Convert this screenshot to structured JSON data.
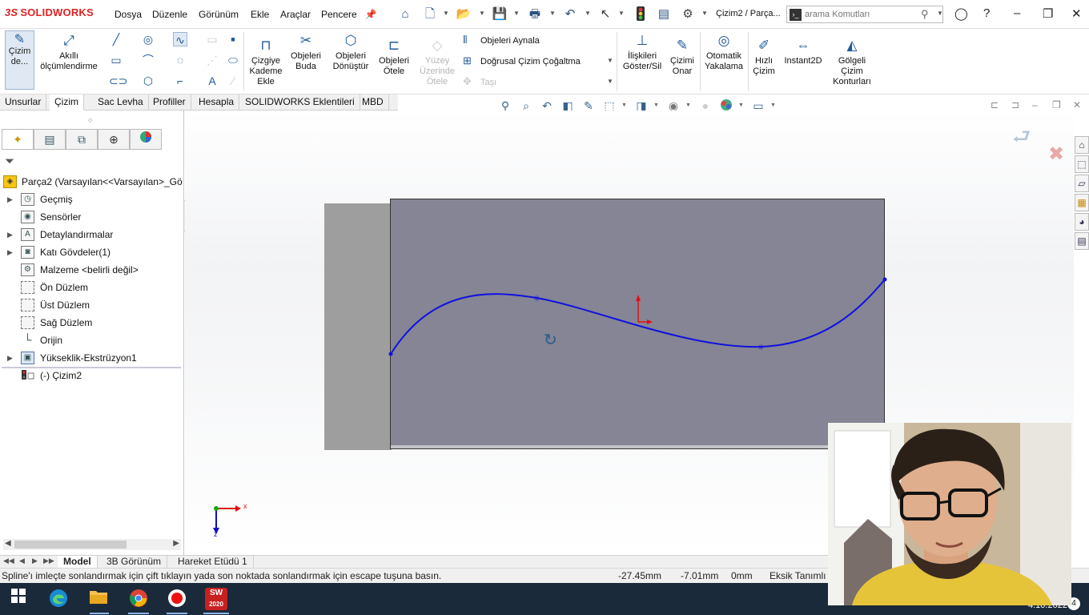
{
  "app": {
    "brand": "SOLIDWORKS",
    "brand_prefix": "3S",
    "doc_title": "Çizim2 / Parça...",
    "accent_color": "#1f5a9a",
    "brand_color": "#dd2222"
  },
  "menu": [
    "Dosya",
    "Düzenle",
    "Görünüm",
    "Ekle",
    "Araçlar",
    "Pencere"
  ],
  "search": {
    "placeholder": "arama Komutları"
  },
  "ribbon": {
    "cizim": "Çizim de...",
    "akilli": "Akıllı ölçümlendirme",
    "cizgiye_kademe": "Çizgiye Kademe Ekle",
    "objeleri_buda": "Objeleri Buda",
    "objeleri_donustur": "Objeleri Dönüştür",
    "objeleri_otele": "Objeleri Ötele",
    "yuzey_uzerinde_otele": "Yüzey Üzerinde Ötele",
    "objeleri_aynala": "Objeleri Aynala",
    "dogrusal_cizim": "Doğrusal Çizim Çoğaltma",
    "tasi": "Taşı",
    "iliskileri": "İlişkileri Göster/Sil",
    "cizimi_onar": "Çizimi Onar",
    "otomatik_yakalama": "Otomatik Yakalama",
    "hizli_cizim": "Hızlı Çizim",
    "instant2d": "Instant2D",
    "golgeli": "Gölgeli Çizim Konturları"
  },
  "cm_tabs": [
    "Unsurlar",
    "Çizim",
    "Sac Levha",
    "Profiller",
    "Hesapla",
    "SOLIDWORKS Eklentileri",
    "MBD"
  ],
  "cm_active": "Çizim",
  "tree": {
    "root": "Parça2  (Varsayılan<<Varsayılan>_Gör",
    "items": [
      {
        "label": "Geçmiş",
        "expand": true
      },
      {
        "label": "Sensörler",
        "expand": false
      },
      {
        "label": "Detaylandırmalar",
        "expand": true
      },
      {
        "label": "Katı Gövdeler(1)",
        "expand": true
      },
      {
        "label": "Malzeme <belirli değil>",
        "expand": false
      },
      {
        "label": "Ön Düzlem",
        "expand": false
      },
      {
        "label": "Üst Düzlem",
        "expand": false
      },
      {
        "label": "Sağ Düzlem",
        "expand": false
      },
      {
        "label": "Orijin",
        "expand": false
      },
      {
        "label": "Yükseklik-Ekstrüzyon1",
        "expand": true
      },
      {
        "label": "(-) Çizim2",
        "expand": false
      }
    ]
  },
  "model_tabs": [
    "Model",
    "3B Görünüm",
    "Hareket Etüdü 1"
  ],
  "model_active": "Model",
  "status": {
    "message": "Spline'ı imleçte sonlandırmak için çift tıklayın yada son noktada sonlandırmak için escape tuşuna basın.",
    "x": "-27.45mm",
    "y": "-7.01mm",
    "z": "0mm",
    "state": "Eksik Tanımlı"
  },
  "triad": {
    "x": "x",
    "y": "y",
    "z": "z"
  },
  "taskbar": {
    "date": "4.10.2022",
    "notifications": "4",
    "sw_version": "2020"
  },
  "colors": {
    "part_face": "#858595",
    "part_side": "#9e9e9e",
    "spline": "#1010e0"
  }
}
